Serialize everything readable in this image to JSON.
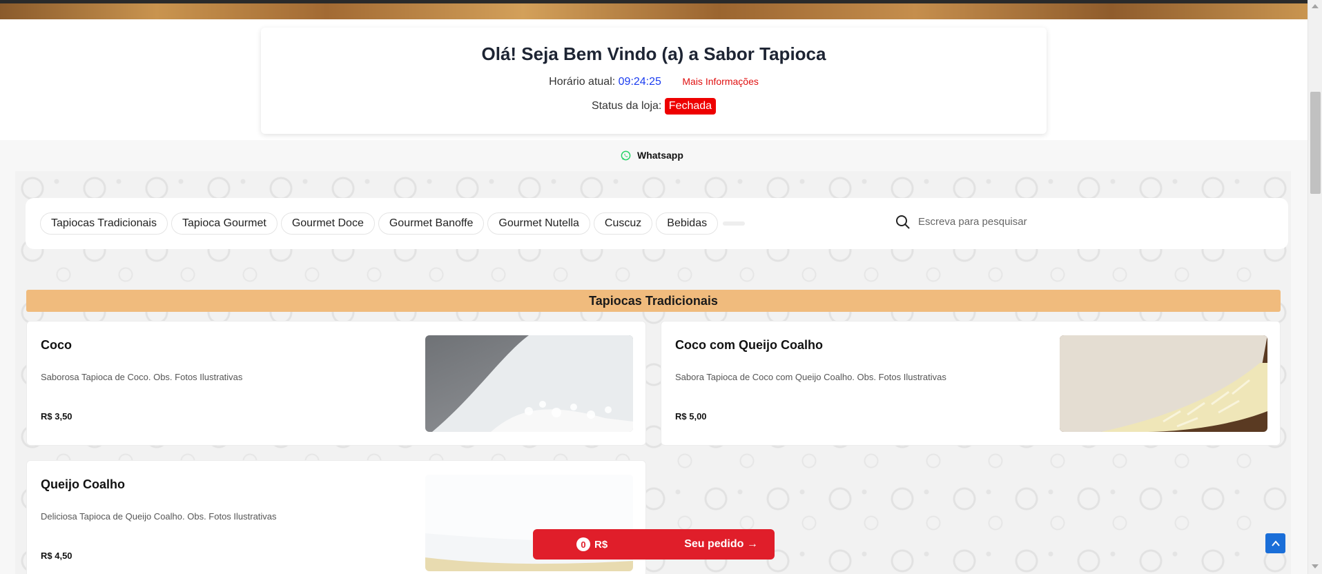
{
  "header": {
    "welcome": "Olá! Seja Bem Vindo (a) a Sabor Tapioca",
    "time_label": "Horário atual:",
    "time_value": "09:24:25",
    "more_info": "Mais Informações",
    "status_label": "Status da loja:",
    "status_value": "Fechada",
    "status_color": "#ee0000"
  },
  "contact": {
    "whatsapp_label": "Whatsapp",
    "icon": "whatsapp-icon",
    "color": "#25d366"
  },
  "categories": [
    "Tapiocas Tradicionais",
    "Tapioca Gourmet",
    "Gourmet Doce",
    "Gourmet Banoffe",
    "Gourmet Nutella",
    "Cuscuz",
    "Bebidas"
  ],
  "search": {
    "placeholder": "Escreva para pesquisar",
    "icon": "search-icon"
  },
  "section": {
    "title": "Tapiocas Tradicionais",
    "color": "#f0bb7d"
  },
  "products": [
    {
      "name": "Coco",
      "description": "Saborosa Tapioca de Coco. Obs. Fotos Ilustrativas",
      "price": "R$ 3,50"
    },
    {
      "name": "Coco com Queijo Coalho",
      "description": "Sabora Tapioca de Coco com Queijo Coalho. Obs. Fotos Ilustrativas",
      "price": "R$ 5,00"
    },
    {
      "name": "Queijo Coalho",
      "description": "Deliciosa Tapioca de Queijo Coalho. Obs. Fotos Ilustrativas",
      "price": "R$ 4,50"
    }
  ],
  "cart": {
    "count": "0",
    "total": "R$",
    "label": "Seu pedido →",
    "color": "#e01e2a"
  },
  "back_to_top": {
    "icon": "arrow-up-icon",
    "color": "#1a6ed8"
  }
}
